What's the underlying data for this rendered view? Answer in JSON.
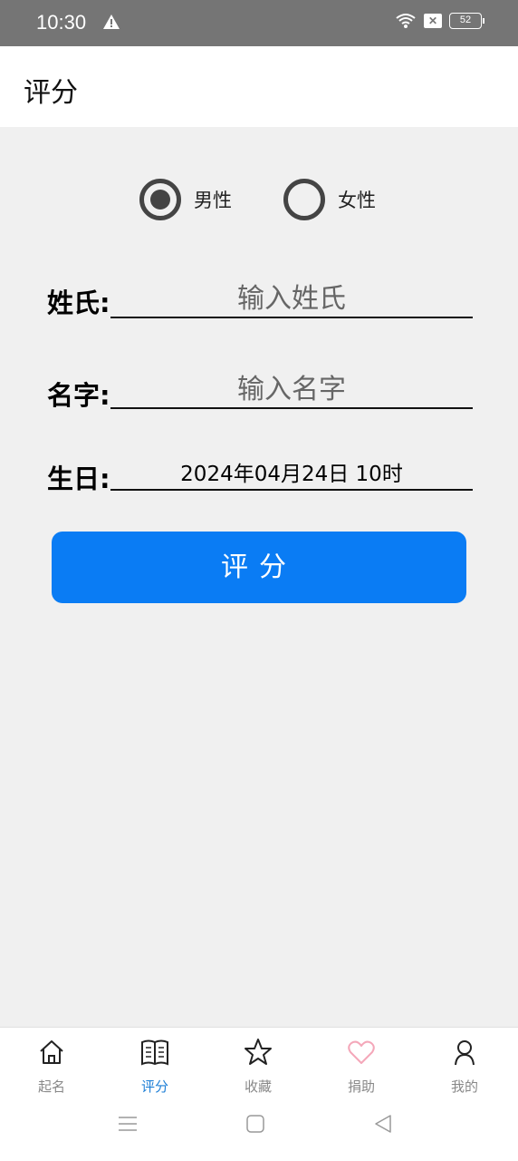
{
  "status_bar": {
    "time": "10:30",
    "battery": "52",
    "icons": [
      "warning-icon",
      "wifi-icon",
      "sim-off-icon",
      "battery-icon"
    ]
  },
  "app_bar": {
    "title": "评分"
  },
  "gender": {
    "options": [
      {
        "label": "男性",
        "checked": true
      },
      {
        "label": "女性",
        "checked": false
      }
    ]
  },
  "form": {
    "surname": {
      "label": "姓氏:",
      "placeholder": "输入姓氏",
      "value": ""
    },
    "given_name": {
      "label": "名字:",
      "placeholder": "输入名字",
      "value": ""
    },
    "birthday": {
      "label": "生日:",
      "value": "2024年04月24日 10时"
    }
  },
  "score_button": {
    "label": "评分"
  },
  "bottom_nav": {
    "items": [
      {
        "label": "起名",
        "icon": "home-icon",
        "active": false
      },
      {
        "label": "评分",
        "icon": "book-icon",
        "active": true
      },
      {
        "label": "收藏",
        "icon": "star-icon",
        "active": false
      },
      {
        "label": "捐助",
        "icon": "heart-icon",
        "active": false
      },
      {
        "label": "我的",
        "icon": "person-icon",
        "active": false
      }
    ],
    "active_color": "#1e7fd6",
    "heart_color": "#f4a7b9"
  },
  "system_nav": {
    "icons": [
      "menu-icon",
      "home-square-icon",
      "back-triangle-icon"
    ]
  },
  "colors": {
    "primary": "#0a7cf4",
    "status_bar": "#757575",
    "background": "#f0f0f0"
  }
}
